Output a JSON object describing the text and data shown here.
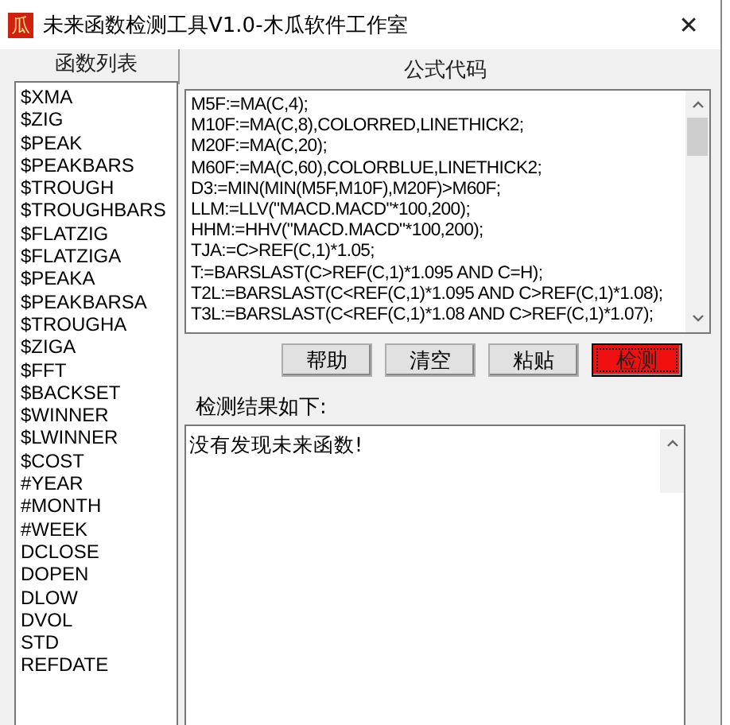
{
  "window": {
    "icon_glyph": "瓜",
    "title": "未来函数检测工具V1.0-木瓜软件工作室",
    "close_glyph": "✕"
  },
  "function_list": {
    "header": "函数列表",
    "items": [
      "$XMA",
      "$ZIG",
      "$PEAK",
      "$PEAKBARS",
      "$TROUGH",
      "$TROUGHBARS",
      "$FLATZIG",
      "$FLATZIGA",
      "$PEAKA",
      "$PEAKBARSA",
      "$TROUGHA",
      "$ZIGA",
      "$FFT",
      "$BACKSET",
      "$WINNER",
      "$LWINNER",
      "$COST",
      "#YEAR",
      "#MONTH",
      "#WEEK",
      "DCLOSE",
      "DOPEN",
      "DLOW",
      "DVOL",
      "STD",
      "REFDATE"
    ]
  },
  "code": {
    "header": "公式代码",
    "lines": [
      "M5F:=MA(C,4);",
      "M10F:=MA(C,8),COLORRED,LINETHICK2;",
      "M20F:=MA(C,20);",
      "M60F:=MA(C,60),COLORBLUE,LINETHICK2;",
      "D3:=MIN(MIN(M5F,M10F),M20F)>M60F;",
      "LLM:=LLV(\"MACD.MACD\"*100,200);",
      "HHM:=HHV(\"MACD.MACD\"*100,200);",
      "TJA:=C>REF(C,1)*1.05;",
      "T:=BARSLAST(C>REF(C,1)*1.095 AND C=H);",
      "T2L:=BARSLAST(C<REF(C,1)*1.095 AND C>REF(C,1)*1.08);",
      "T3L:=BARSLAST(C<REF(C,1)*1.08 AND C>REF(C,1)*1.07);"
    ]
  },
  "buttons": [
    {
      "label": "帮助",
      "kind": "normal"
    },
    {
      "label": "清空",
      "kind": "normal"
    },
    {
      "label": "粘贴",
      "kind": "normal"
    },
    {
      "label": "检测",
      "kind": "alert"
    }
  ],
  "result": {
    "label": "检测结果如下:",
    "text": "没有发现未来函数!"
  }
}
